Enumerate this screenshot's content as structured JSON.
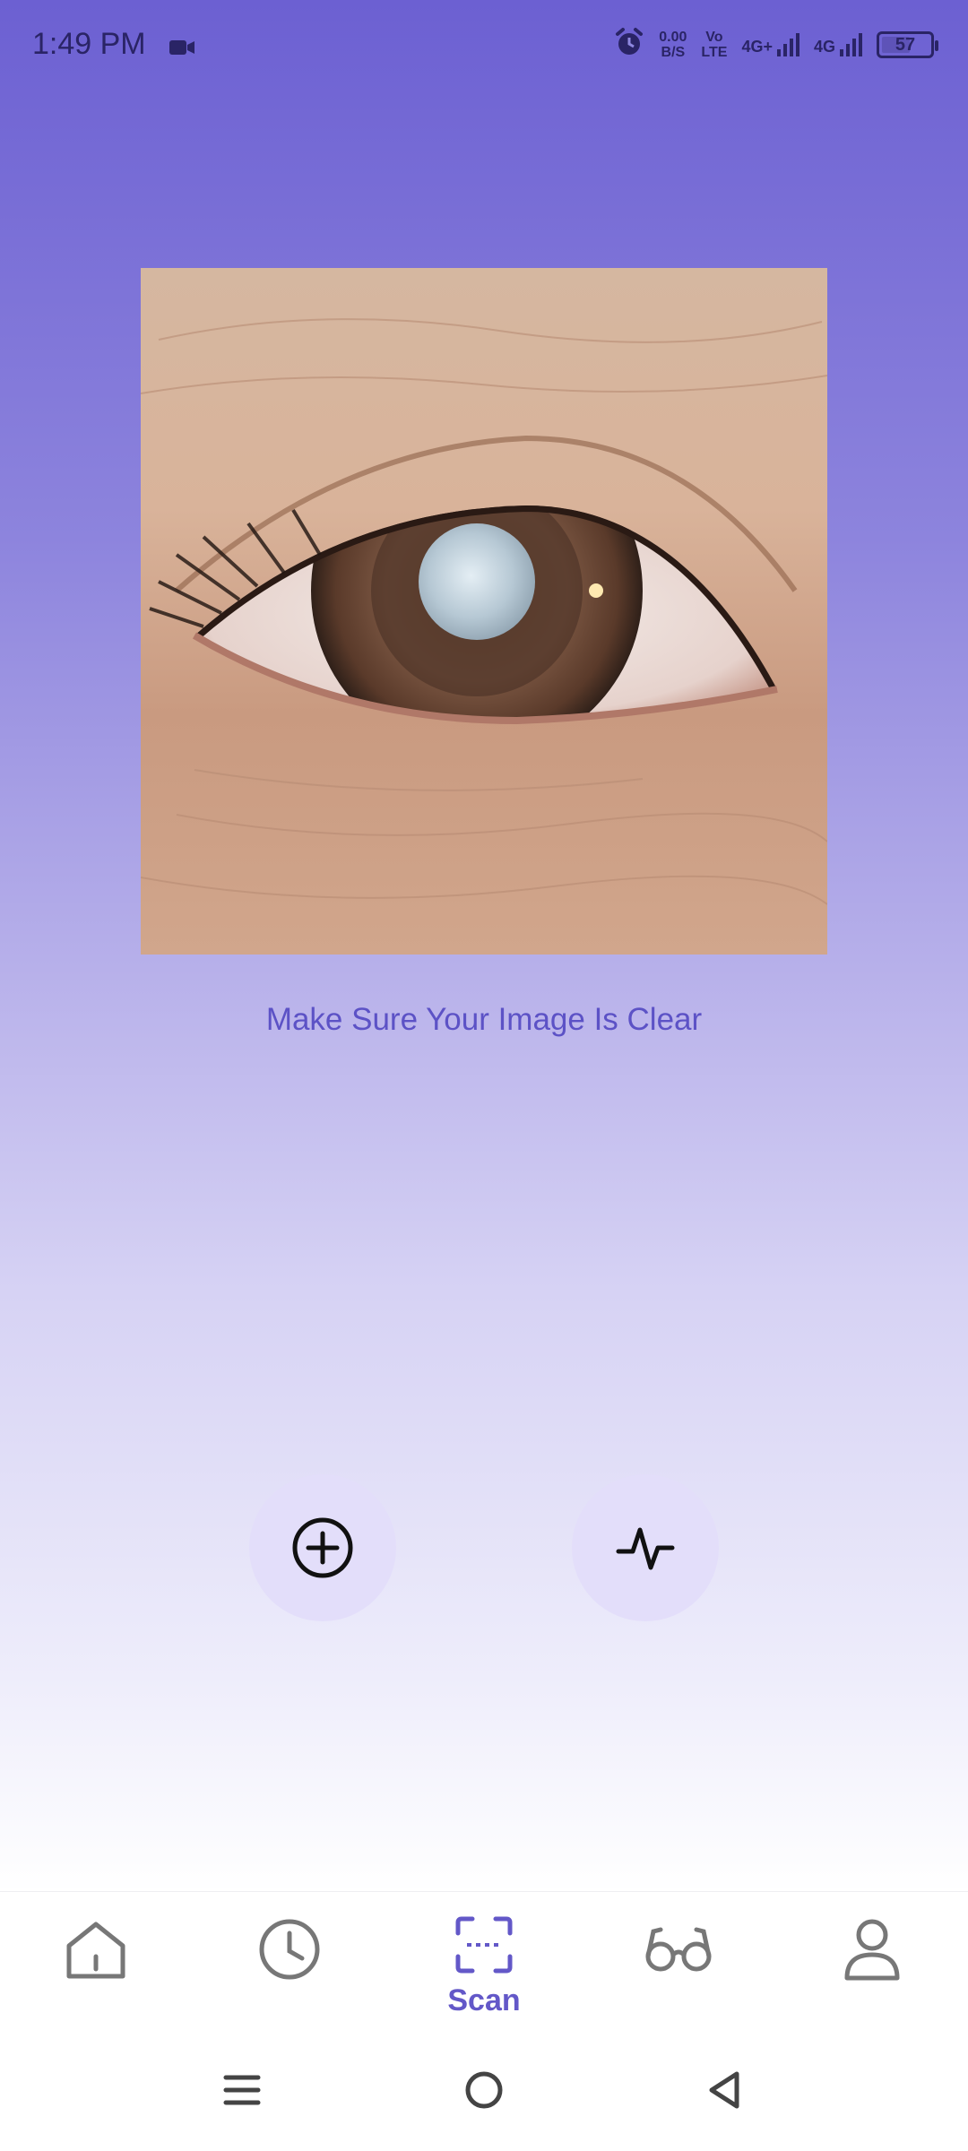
{
  "status_bar": {
    "time": "1:49 PM",
    "net_speed_top": "0.00",
    "net_speed_bottom": "B/S",
    "volte_top": "Vo",
    "volte_bottom": "LTE",
    "sim1_label": "4G+",
    "sim2_label": "4G",
    "battery": "57"
  },
  "scan": {
    "caption": "Make Sure Your Image Is Clear"
  },
  "bottom_nav": {
    "active": "scan",
    "scan_label": "Scan"
  },
  "colors": {
    "accent": "#6358C8",
    "button_bg": "#E3DEFA",
    "caption": "#5C52C6"
  },
  "icons": [
    "video-camera-icon",
    "alarm-icon",
    "home-icon",
    "clock-icon",
    "scan-icon",
    "glasses-icon",
    "profile-icon",
    "plus-circle-icon",
    "pulse-icon",
    "menu-icon",
    "home-circle-icon",
    "back-icon"
  ]
}
